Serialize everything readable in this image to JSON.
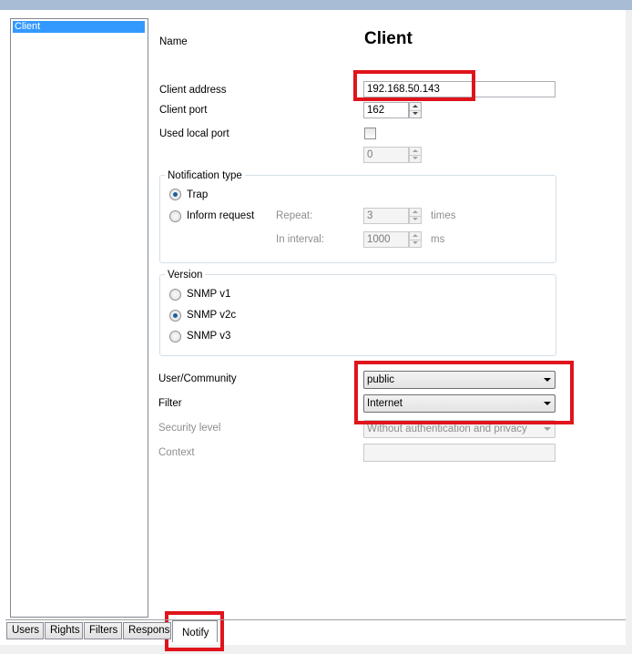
{
  "left_list": {
    "items": [
      "Client"
    ]
  },
  "form": {
    "name_label": "Name",
    "name_value": "Client",
    "client_address_label": "Client address",
    "client_address_value": "192.168.50.143",
    "client_port_label": "Client port",
    "client_port_value": "162",
    "used_local_port_label": "Used local port",
    "local_port_value": "0",
    "notification_type": {
      "title": "Notification type",
      "trap_label": "Trap",
      "inform_label": "Inform request",
      "selected": "Trap",
      "repeat_label": "Repeat:",
      "repeat_value": "3",
      "repeat_unit": "times",
      "interval_label": "In interval:",
      "interval_value": "1000",
      "interval_unit": "ms"
    },
    "version": {
      "title": "Version",
      "options": [
        "SNMP v1",
        "SNMP v2c",
        "SNMP v3"
      ],
      "selected": "SNMP v2c"
    },
    "user_community_label": "User/Community",
    "user_community_value": "public",
    "filter_label": "Filter",
    "filter_value": "Internet",
    "security_level_label": "Security level",
    "security_level_value": "Without authentication and privacy",
    "context_label": "Context",
    "context_value": ""
  },
  "tabs": [
    {
      "label": "Users"
    },
    {
      "label": "Rights"
    },
    {
      "label": "Filters"
    },
    {
      "label": "Responses"
    },
    {
      "label": "Notify",
      "active": true
    }
  ],
  "colors": {
    "highlight_annotation": "#e0141c",
    "selection": "#3399ff",
    "title_bar": "#a8bcd6"
  }
}
